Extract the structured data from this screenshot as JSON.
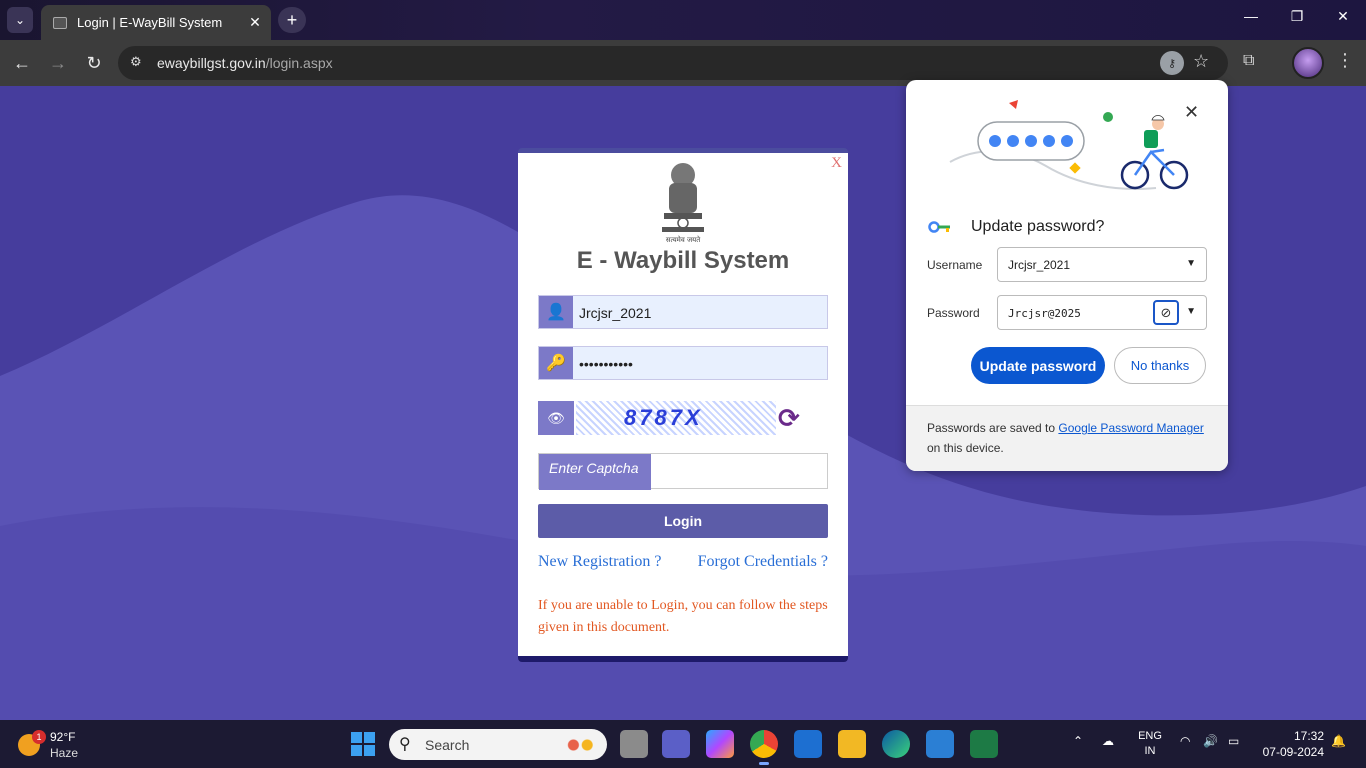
{
  "browser": {
    "tab_title": "Login | E-WayBill System",
    "url_domain": "ewaybillgst.gov.in",
    "url_path": "/login.aspx"
  },
  "login": {
    "close_label": "X",
    "emblem_motto": "सत्यमेव जयते",
    "title": "E - Waybill System",
    "username_value": "Jrcjsr_2021",
    "password_value": "•••••••••••",
    "captcha_text": "8787X",
    "captcha_label": "Enter Captcha",
    "login_button": "Login",
    "new_registration_link": "New Registration ?",
    "forgot_link": "Forgot Credentials ?",
    "help_text": "If you are unable to Login, you can follow the steps given in this document."
  },
  "password_bubble": {
    "title": "Update password?",
    "username_label": "Username",
    "username_value": "Jrcjsr_2021",
    "password_label": "Password",
    "password_value": "Jrcjsr@2025",
    "update_button": "Update password",
    "no_thanks_button": "No thanks",
    "footer_prefix": "Passwords are saved to ",
    "footer_link": "Google Password Manager",
    "footer_suffix": "on this device."
  },
  "taskbar": {
    "weather_temp": "92°F",
    "weather_cond": "Haze",
    "weather_badge": "1",
    "search_placeholder": "Search",
    "lang_top": "ENG",
    "lang_bottom": "IN",
    "time": "17:32",
    "date": "07-09-2024"
  },
  "colors": {
    "page_bg": "#463d9d",
    "accent_blue": "#0b57d0",
    "field_icon": "#7c79c8"
  }
}
